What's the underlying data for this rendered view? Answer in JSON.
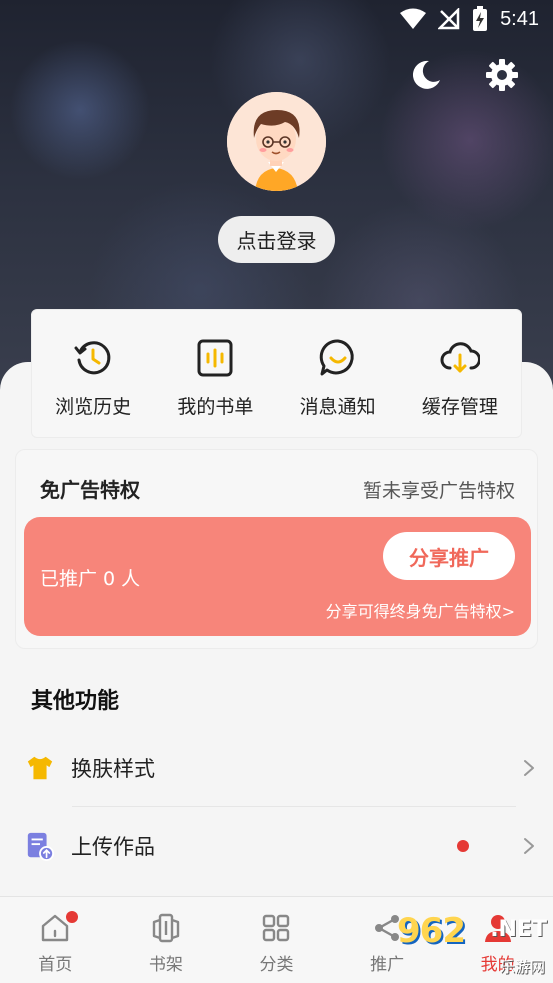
{
  "status_bar": {
    "time": "5:41"
  },
  "profile": {
    "login_label": "点击登录"
  },
  "quick_actions": [
    {
      "label": "浏览历史",
      "icon": "history-icon"
    },
    {
      "label": "我的书单",
      "icon": "booklist-icon"
    },
    {
      "label": "消息通知",
      "icon": "message-icon"
    },
    {
      "label": "缓存管理",
      "icon": "cloud-download-icon"
    }
  ],
  "ad_free": {
    "title": "免广告特权",
    "status": "暂未享受广告特权",
    "promoted_count": "已推广 0 人",
    "share_button": "分享推广",
    "share_hint": "分享可得终身免广告特权>"
  },
  "other_features": {
    "title": "其他功能",
    "items": [
      {
        "label": "换肤样式",
        "icon": "tshirt-icon"
      },
      {
        "label": "上传作品",
        "icon": "upload-doc-icon"
      }
    ]
  },
  "tab_bar": [
    {
      "label": "首页",
      "icon": "home-icon"
    },
    {
      "label": "书架",
      "icon": "bookshelf-icon"
    },
    {
      "label": "分类",
      "icon": "category-icon"
    },
    {
      "label": "推广",
      "icon": "share-icon"
    },
    {
      "label": "我的",
      "icon": "profile-icon"
    }
  ],
  "watermark": {
    "num": "962",
    "net": ".NET",
    "cn": "乐游网"
  },
  "colors": {
    "accent_red": "#e53935",
    "promo_banner": "#f7857a",
    "share_text": "#f0685a",
    "tshirt": "#f5b800",
    "upload": "#7b7fe0"
  }
}
